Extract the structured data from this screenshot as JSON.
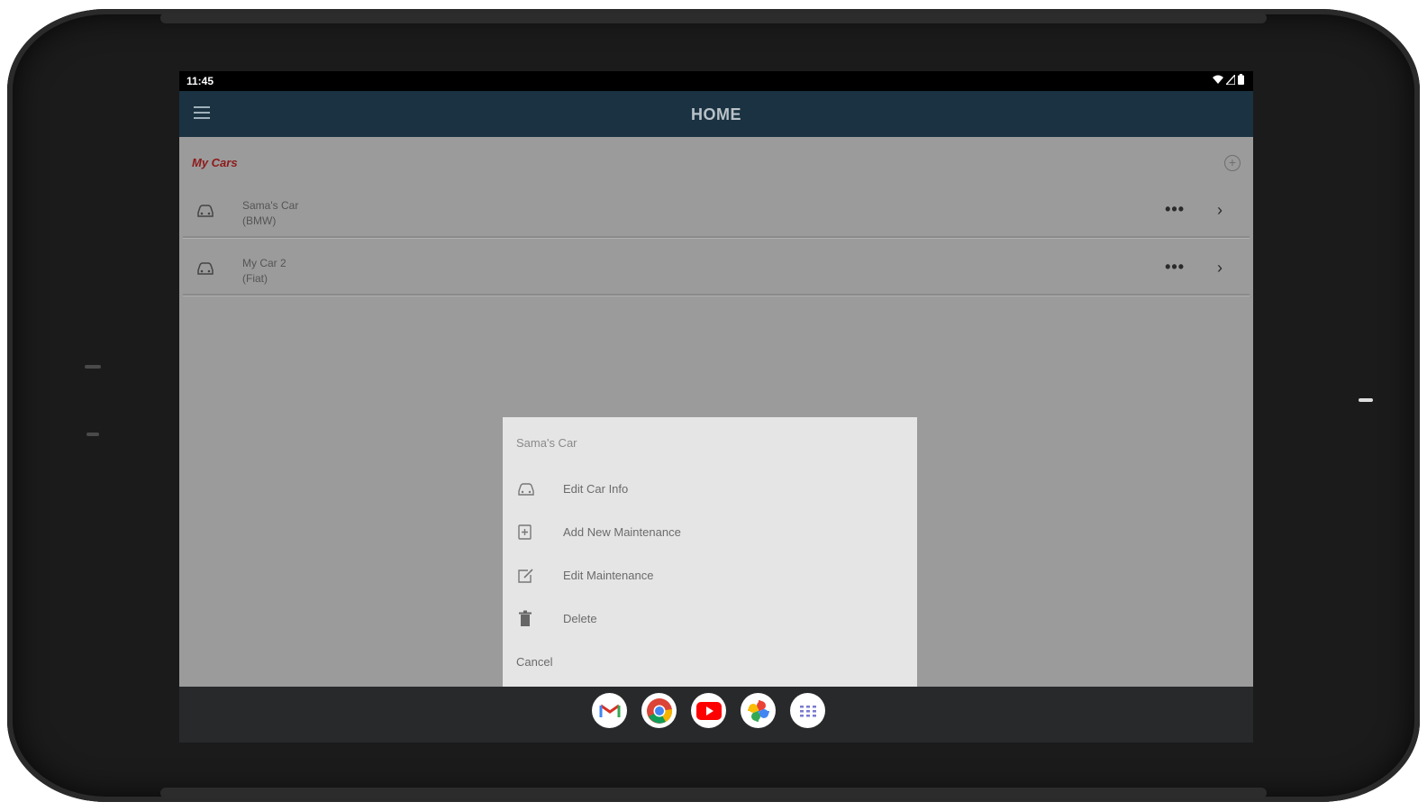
{
  "status_bar": {
    "time": "11:45"
  },
  "app_bar": {
    "title": "HOME"
  },
  "section": {
    "title": "My Cars"
  },
  "cars": [
    {
      "name": "Sama's Car",
      "make": "(BMW)"
    },
    {
      "name": "My Car 2",
      "make": "(Fiat)"
    }
  ],
  "row_actions": {
    "more": "•••",
    "open": "›"
  },
  "action_sheet": {
    "title": "Sama's Car",
    "options": [
      {
        "label": "Edit Car Info",
        "icon": "car-icon"
      },
      {
        "label": "Add New Maintenance",
        "icon": "add-document-icon"
      },
      {
        "label": "Edit Maintenance",
        "icon": "edit-icon"
      },
      {
        "label": "Delete",
        "icon": "trash-icon"
      }
    ],
    "cancel": "Cancel"
  },
  "dock": {
    "apps": [
      "gmail-icon",
      "chrome-icon",
      "youtube-icon",
      "photos-icon",
      "app-drawer-icon"
    ]
  },
  "colors": {
    "app_bar": "#1a3241",
    "section_title": "#8e1a1a",
    "content_background": "#9b9b9b",
    "sheet_background": "#e5e5e5"
  }
}
